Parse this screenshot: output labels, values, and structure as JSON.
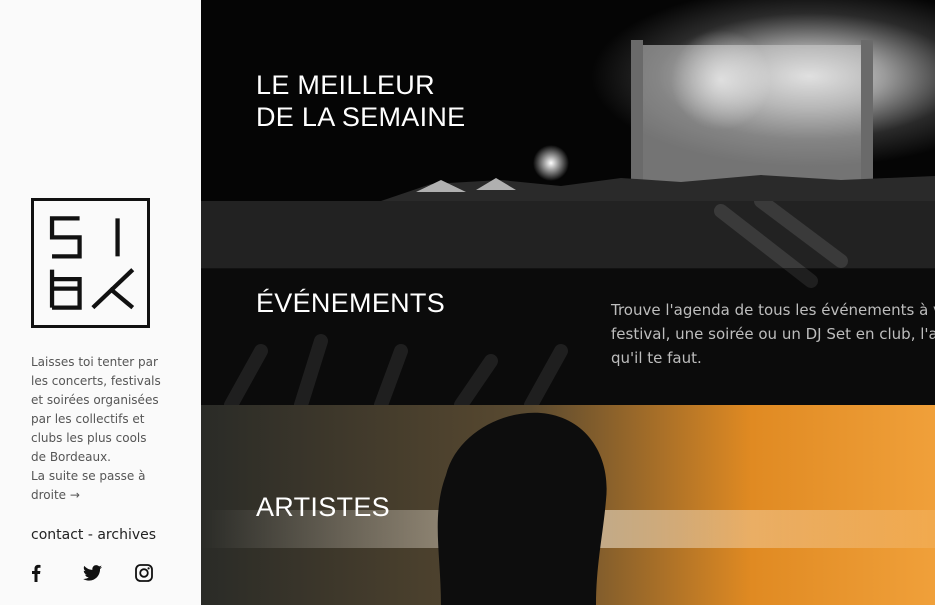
{
  "sidebar": {
    "logo_text": "SIBX",
    "intro": [
      "Laisses toi tenter par les concerts, festivals et soirées organisées par les collectifs et clubs les plus cools de Bordeaux.",
      "La suite se passe à droite →"
    ],
    "links": {
      "contact": "contact",
      "separator": " - ",
      "archives": "archives"
    },
    "social_icons": [
      "facebook-icon",
      "twitter-icon",
      "instagram-icon"
    ]
  },
  "sections": [
    {
      "title_line1": "LE MEILLEUR",
      "title_line2": "DE LA SEMAINE"
    },
    {
      "title": "ÉVÉNEMENTS",
      "desc_line1": "Trouve l'agenda de tous les événements à v",
      "desc_line2": "festival, une soirée ou un DJ Set en club, l'ag",
      "desc_line3": "qu'il te faut."
    },
    {
      "title": "ARTISTES"
    }
  ]
}
